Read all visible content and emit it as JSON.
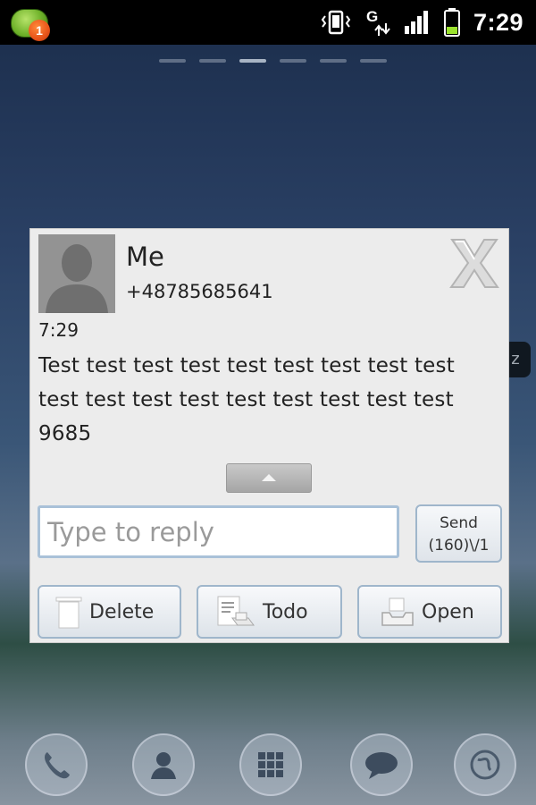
{
  "statusbar": {
    "notification_count": "1",
    "time": "7:29",
    "icons": [
      "vibrate-icon",
      "data-g-icon",
      "signal-icon",
      "battery-icon"
    ]
  },
  "home": {
    "page_count": 6,
    "active_page": 3,
    "edge_badge_text": "z"
  },
  "popup": {
    "contact_name": "Me",
    "contact_phone": "+48785685641",
    "message_time": "7:29",
    "message_body": "Test test test test test test test test test test test test test test test test test test 9685",
    "reply_placeholder": "Type to reply",
    "send_label": "Send",
    "send_counter": "(160)\\/1",
    "buttons": {
      "delete": "Delete",
      "todo": "Todo",
      "open": "Open"
    }
  },
  "dock": {
    "icons": [
      "phone-icon",
      "contacts-icon",
      "app-drawer-icon",
      "messaging-icon",
      "browser-icon"
    ]
  },
  "colors": {
    "popup_bg": "#ececec",
    "button_border": "#9fb6cb",
    "statusbar_bg": "#000000"
  }
}
